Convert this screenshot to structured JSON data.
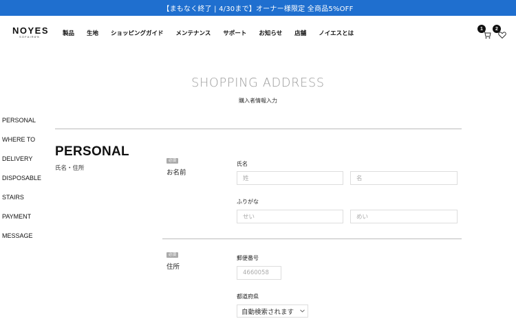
{
  "promo": {
    "text": "【まもなく終了 | 4/30まで】オーナー様限定 全商品5%OFF"
  },
  "header": {
    "brand": "NOYES",
    "brand_sub": "SOFAIR8%",
    "nav": [
      "製品",
      "生地",
      "ショッピングガイド",
      "メンテナンス",
      "サポート",
      "お知らせ",
      "店舗",
      "ノイエスとは"
    ],
    "cart_count": "1",
    "fav_count": "2"
  },
  "page": {
    "title": "SHOPPING ADDRESS",
    "subtitle": "購入者情報入力"
  },
  "sidenav": [
    "PERSONAL",
    "WHERE TO",
    "DELIVERY",
    "DISPOSABLE",
    "STAIRS",
    "PAYMENT",
    "MESSAGE"
  ],
  "section": {
    "title": "PERSONAL",
    "subtitle": "氏名・住所"
  },
  "name_row": {
    "required": "必須",
    "label": "お名前",
    "name_label": "氏名",
    "last_placeholder": "姓",
    "first_placeholder": "名",
    "kana_label": "ふりがな",
    "last_kana_placeholder": "せい",
    "first_kana_placeholder": "めい"
  },
  "address_row": {
    "required": "必須",
    "label": "住所",
    "zip_label": "郵便番号",
    "zip_placeholder": "4660058",
    "pref_label": "都道府県",
    "pref_value": "自動検索されます"
  }
}
